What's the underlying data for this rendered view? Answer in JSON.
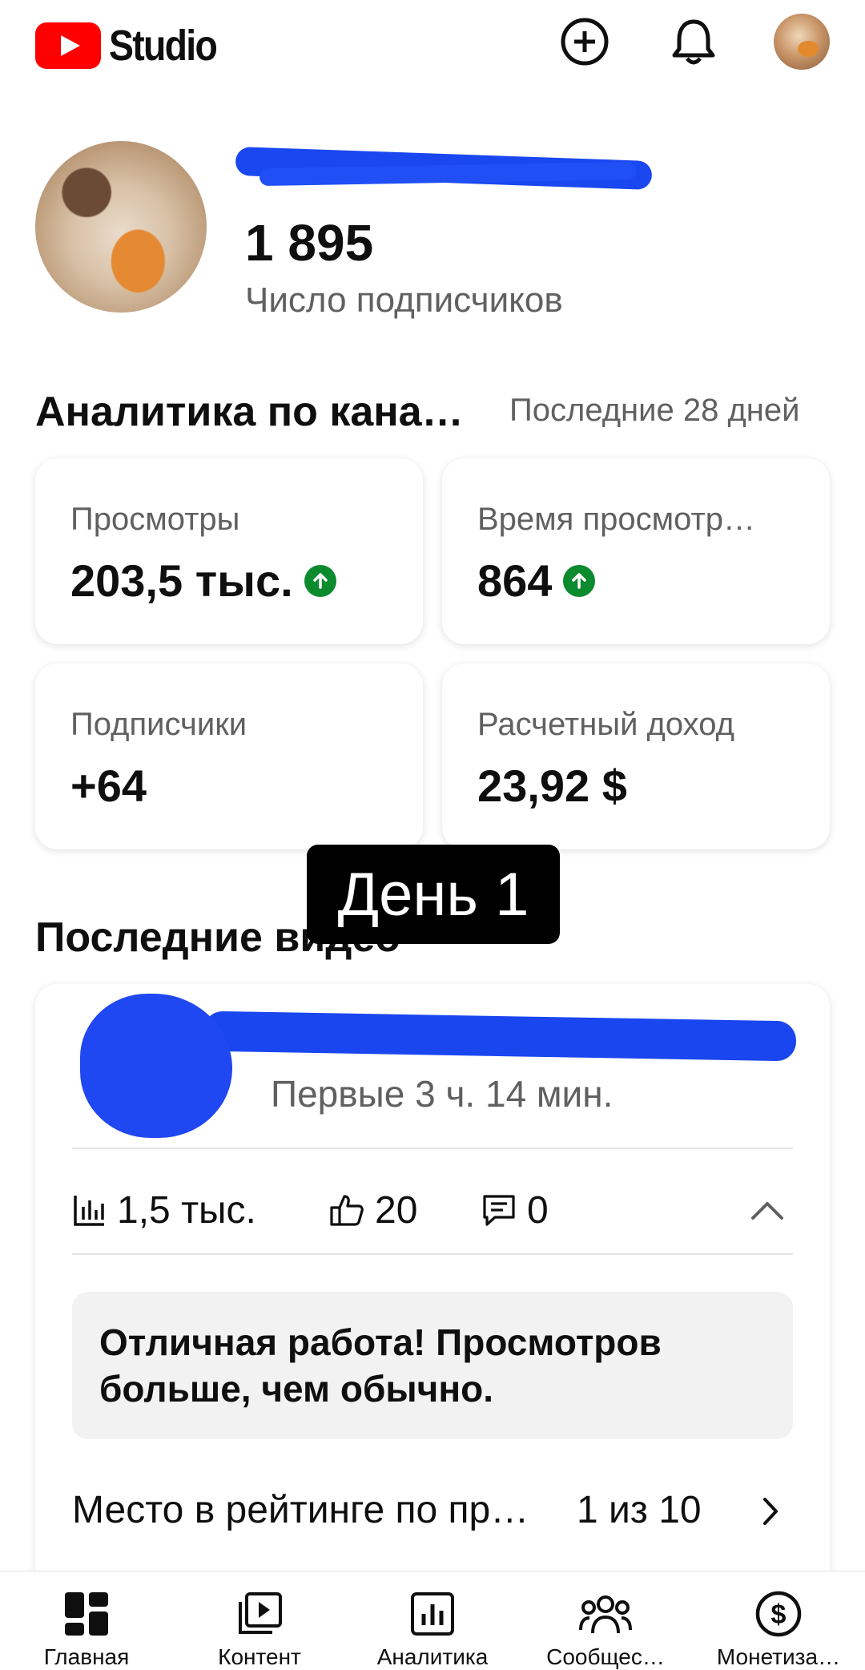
{
  "header": {
    "logo_text": "Studio",
    "icons": [
      "youtube-play-icon",
      "add-circle-icon",
      "bell-icon",
      "account-avatar"
    ]
  },
  "channel": {
    "subscribers_count": "1 895",
    "subscribers_label": "Число подписчиков"
  },
  "analytics": {
    "title": "Аналитика по кана…",
    "range": "Последние 28 дней",
    "cards": [
      {
        "label": "Просмотры",
        "value": "203,5 тыс.",
        "trend": "up"
      },
      {
        "label": "Время просмотр…",
        "value": "864",
        "trend": "up"
      },
      {
        "label": "Подписчики",
        "value": "+64",
        "trend": "none"
      },
      {
        "label": "Расчетный доход",
        "value": "23,92 $",
        "trend": "none"
      }
    ]
  },
  "overlay": {
    "text": "День 1"
  },
  "recent_videos": {
    "title": "Последние видео",
    "video": {
      "subtitle": "Первые 3 ч. 14 мин.",
      "views": "1,5 тыс.",
      "likes": "20",
      "comments": "0",
      "insight": "Отличная работа! Просмотров больше, чем обычно.",
      "rank_label": "Место в рейтинге по пр…",
      "rank_value": "1 из 10"
    }
  },
  "bottom_nav": {
    "items": [
      {
        "label": "Главная",
        "icon": "dashboard-icon"
      },
      {
        "label": "Контент",
        "icon": "content-icon"
      },
      {
        "label": "Аналитика",
        "icon": "analytics-icon"
      },
      {
        "label": "Сообщес…",
        "icon": "community-icon"
      },
      {
        "label": "Монетиза…",
        "icon": "monetization-icon"
      }
    ]
  },
  "colors": {
    "brand_red": "#ff0000",
    "trend_green": "#0c8a2e",
    "redaction_blue": "#1a46f0",
    "secondary_text": "#606060"
  }
}
